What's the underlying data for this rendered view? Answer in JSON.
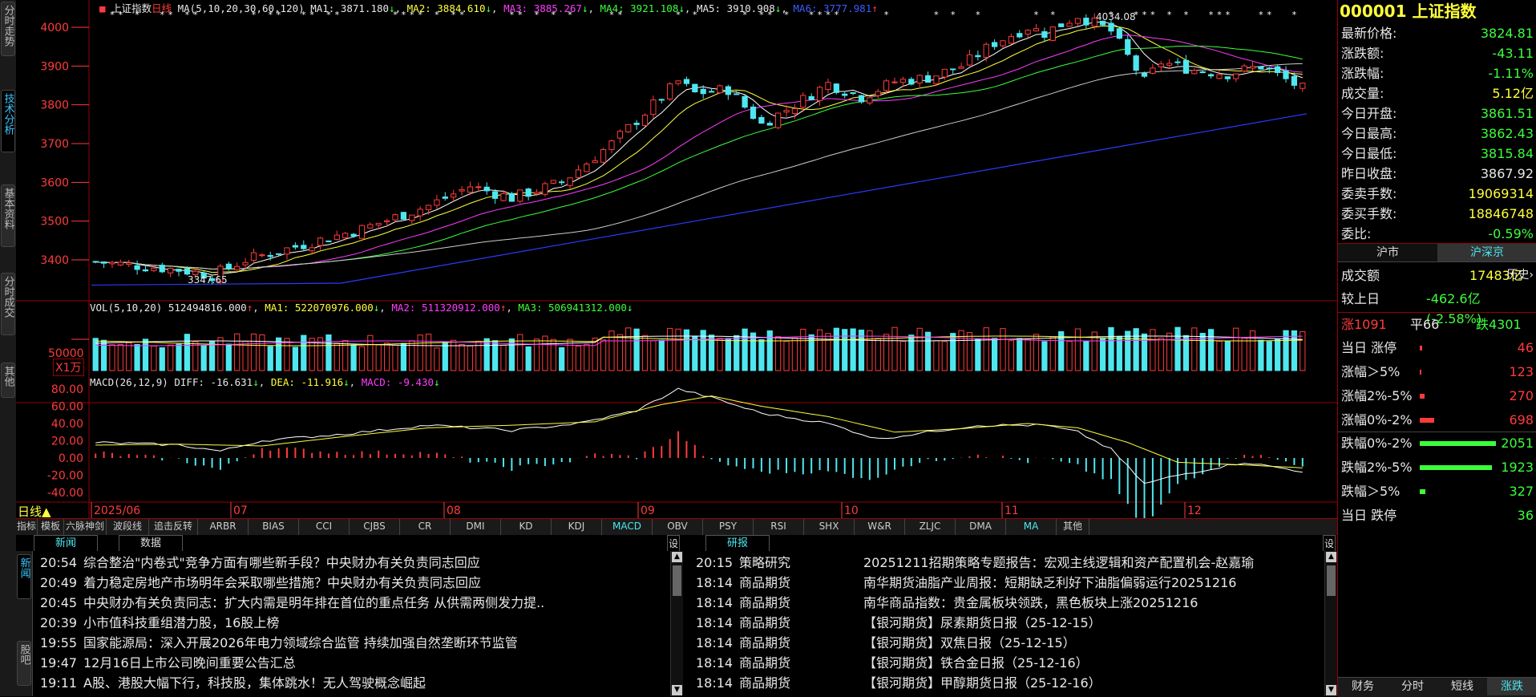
{
  "left_tabs": [
    "分时走势",
    "技术分析",
    "基本资料",
    "分时成交",
    "其他"
  ],
  "chart_header": {
    "index_name": "上证指数",
    "period": "日线",
    "ma_label": "MA(5,10,20,30,60,120)",
    "ma1": "MA1: 3871.180",
    "ma2": "MA2: 3884.610",
    "ma3": "MA3: 3885.267",
    "ma4": "MA4: 3921.108",
    "ma5": "MA5: 3910.908",
    "ma6": "MA6: 3777.981"
  },
  "price_axis": [
    "4000",
    "3900",
    "3800",
    "3700",
    "3600",
    "3500",
    "3400"
  ],
  "price_annotations": {
    "high": "4034.08",
    "low": "3347.65"
  },
  "vol_header": {
    "label": "VOL(5,10,20)",
    "value": "512494816.000",
    "ma1": "MA1: 522070976.000",
    "ma2": "MA2: 511320912.000",
    "ma3": "MA3: 506941312.000"
  },
  "vol_axis": {
    "tick": "50000",
    "unit": "X1万"
  },
  "macd_header": {
    "label": "MACD(26,12,9)",
    "diff": "DIFF: -16.631",
    "dea": "DEA: -11.916",
    "macd": "MACD: -9.430"
  },
  "macd_axis": [
    "80.00",
    "60.00",
    "40.00",
    "20.00",
    "0.00",
    "-20.00",
    "-40.00"
  ],
  "date_axis": {
    "period_label": "日线▲",
    "months": [
      "2025/06",
      "07",
      "08",
      "09",
      "10",
      "11",
      "12"
    ]
  },
  "indicator_tabs": [
    "指标",
    "模板",
    "六脉神剑",
    "波段线",
    "追击反转",
    "ARBR",
    "BIAS",
    "CCI",
    "CJBS",
    "CR",
    "DMI",
    "KD",
    "KDJ",
    "MACD",
    "OBV",
    "PSY",
    "RSI",
    "SHX",
    "W&R",
    "ZLJC",
    "DMA",
    "MA",
    "其他"
  ],
  "news_left": {
    "tabs": [
      "新闻",
      "数据"
    ],
    "side_tabs": [
      "新闻",
      "股吧"
    ],
    "settings": "设",
    "items": [
      {
        "time": "20:54",
        "title": "综合整治\"内卷式\"竞争方面有哪些新手段？中央财办有关负责同志回应"
      },
      {
        "time": "20:49",
        "title": "着力稳定房地产市场明年会采取哪些措施？中央财办有关负责同志回应"
      },
      {
        "time": "20:45",
        "title": "中央财办有关负责同志：扩大内需是明年排在首位的重点任务 从供需两侧发力提.."
      },
      {
        "time": "20:39",
        "title": "小市值科技重组潜力股，16股上榜"
      },
      {
        "time": "19:55",
        "title": "国家能源局：深入开展2026年电力领域综合监管 持续加强自然垄断环节监管"
      },
      {
        "time": "19:47",
        "title": "12月16日上市公司晚间重要公告汇总"
      },
      {
        "time": "19:11",
        "title": "A股、港股大幅下行，科技股，集体跳水！无人驾驶概念崛起"
      }
    ]
  },
  "news_right": {
    "tab": "研报",
    "settings": "设",
    "items": [
      {
        "time": "20:15",
        "cat": "策略研究",
        "title": "20251211招期策略专题报告：宏观主线逻辑和资产配置机会-赵嘉瑜"
      },
      {
        "time": "18:14",
        "cat": "商品期货",
        "title": "南华期货油脂产业周报：短期缺乏利好下油脂偏弱运行20251216"
      },
      {
        "time": "18:14",
        "cat": "商品期货",
        "title": "南华商品指数：贵金属板块领跌，黑色板块上涨20251216"
      },
      {
        "time": "18:14",
        "cat": "商品期货",
        "title": "【银河期货】尿素期货日报（25-12-15）"
      },
      {
        "time": "18:14",
        "cat": "商品期货",
        "title": "【银河期货】双焦日报（25-12-15）"
      },
      {
        "time": "18:14",
        "cat": "商品期货",
        "title": "【银河期货】铁合金日报（25-12-16）"
      },
      {
        "time": "18:14",
        "cat": "商品期货",
        "title": "【银河期货】甲醇期货日报（25-12-16）"
      }
    ]
  },
  "quote": {
    "code": "000001",
    "name": "上证指数",
    "rows": [
      {
        "k": "最新价格:",
        "v": "3824.81",
        "c": "grn"
      },
      {
        "k": "涨跌额:",
        "v": "-43.11",
        "c": "grn"
      },
      {
        "k": "涨跌幅:",
        "v": "-1.11%",
        "c": "grn"
      },
      {
        "k": "成交量:",
        "v": "5.12亿",
        "c": "yel"
      },
      {
        "k": "今日开盘:",
        "v": "3861.51",
        "c": "grn"
      },
      {
        "k": "今日最高:",
        "v": "3862.43",
        "c": "grn"
      },
      {
        "k": "今日最低:",
        "v": "3815.84",
        "c": "grn"
      },
      {
        "k": "昨日收盘:",
        "v": "3867.92",
        "c": "wht"
      },
      {
        "k": "委卖手数:",
        "v": "19069314",
        "c": "yel"
      },
      {
        "k": "委买手数:",
        "v": "18846748",
        "c": "yel"
      },
      {
        "k": "委比:",
        "v": "-0.59%",
        "c": "grn"
      }
    ],
    "market_tabs": [
      "沪市",
      "沪深京"
    ],
    "turnover": {
      "k": "成交额",
      "v": "17483亿",
      "extra": "历史›"
    },
    "vs_prev": {
      "k": "较上日",
      "v": "-462.6亿(-2.58%)"
    },
    "breadth": {
      "up": "涨1091",
      "flat": "平66",
      "down": "跌4301"
    },
    "dist": [
      {
        "k": "当日 涨停",
        "v": "46",
        "c": "red",
        "frac": 0.01
      },
      {
        "k": "涨幅＞5%",
        "v": "123",
        "c": "red",
        "frac": 0.02
      },
      {
        "k": "涨幅2%-5%",
        "v": "270",
        "c": "red",
        "frac": 0.06
      },
      {
        "k": "涨幅0%-2%",
        "v": "698",
        "c": "red",
        "frac": 0.18
      },
      {
        "k": "跌幅0%-2%",
        "v": "2051",
        "c": "grn",
        "frac": 0.95
      },
      {
        "k": "跌幅2%-5%",
        "v": "1923",
        "c": "grn",
        "frac": 0.9
      },
      {
        "k": "跌幅＞5%",
        "v": "327",
        "c": "grn",
        "frac": 0.07
      },
      {
        "k": "当日 跌停",
        "v": "36",
        "c": "grn",
        "frac": 0.0
      }
    ],
    "bottom_tabs": [
      "财务",
      "分时",
      "短线",
      "涨跌"
    ]
  },
  "colors": {
    "up": "#ff3b3b",
    "down": "#4fe7ef",
    "ma1": "#ffffff",
    "ma2": "#ffff3c",
    "ma3": "#ff3cff",
    "ma4": "#3cff3c",
    "ma5": "#cccccc",
    "ma6": "#2a3cff",
    "border": "#990000"
  }
}
